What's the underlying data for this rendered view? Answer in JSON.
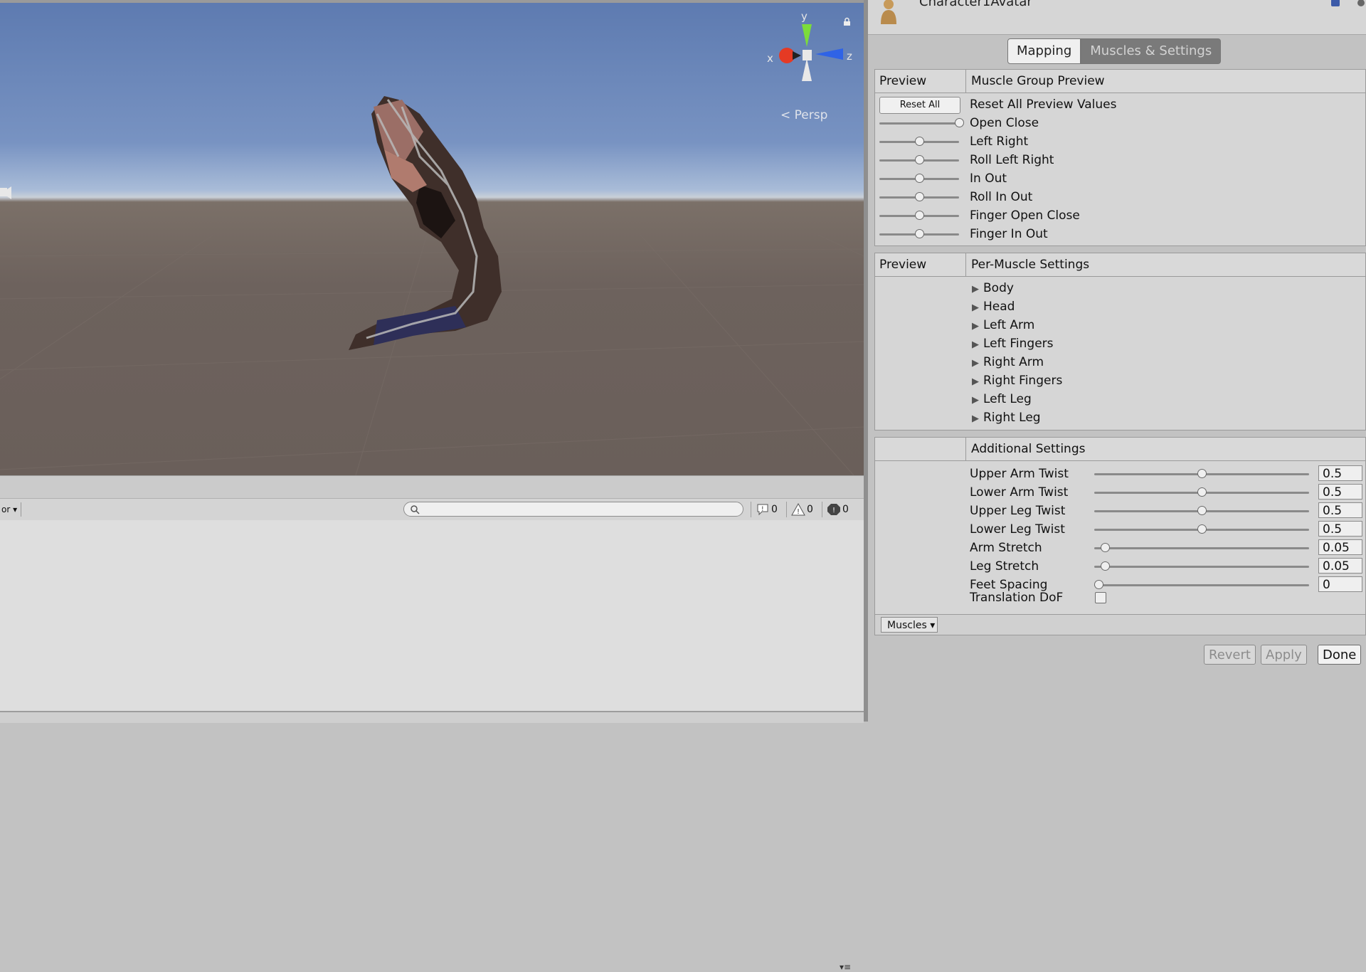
{
  "scene": {
    "projection_label": "Persp",
    "axes": {
      "x": "x",
      "y": "y",
      "z": "z"
    }
  },
  "console": {
    "menu_label": "or",
    "search_placeholder": "",
    "counts": {
      "info": "0",
      "warning": "0",
      "error": "0"
    }
  },
  "inspector": {
    "asset_title": "Character1Avatar",
    "tabs": [
      "Mapping",
      "Muscles & Settings"
    ],
    "active_tab": "Muscles & Settings",
    "muscle_group_preview": {
      "col1": "Preview",
      "col2": "Muscle Group Preview",
      "reset_button": "Reset All",
      "rows": [
        {
          "label": "Reset All Preview Values"
        },
        {
          "label": "Open Close",
          "value": 1.0
        },
        {
          "label": "Left Right",
          "value": 0.5
        },
        {
          "label": "Roll Left Right",
          "value": 0.5
        },
        {
          "label": "In Out",
          "value": 0.5
        },
        {
          "label": "Roll In Out",
          "value": 0.5
        },
        {
          "label": "Finger Open Close",
          "value": 0.5
        },
        {
          "label": "Finger In Out",
          "value": 0.5
        }
      ]
    },
    "per_muscle_settings": {
      "col1": "Preview",
      "col2": "Per-Muscle Settings",
      "items": [
        "Body",
        "Head",
        "Left Arm",
        "Left Fingers",
        "Right Arm",
        "Right Fingers",
        "Left Leg",
        "Right Leg"
      ]
    },
    "additional_settings": {
      "col1": "",
      "col2": "Additional Settings",
      "rows": [
        {
          "label": "Upper Arm Twist",
          "value": "0.5",
          "level": 0.5
        },
        {
          "label": "Lower Arm Twist",
          "value": "0.5",
          "level": 0.5
        },
        {
          "label": "Upper Leg Twist",
          "value": "0.5",
          "level": 0.5
        },
        {
          "label": "Lower Leg Twist",
          "value": "0.5",
          "level": 0.5
        },
        {
          "label": "Arm Stretch",
          "value": "0.05",
          "level": 0.05
        },
        {
          "label": "Leg Stretch",
          "value": "0.05",
          "level": 0.05
        },
        {
          "label": "Feet Spacing",
          "value": "0",
          "level": 0
        }
      ],
      "translation_dof_label": "Translation DoF",
      "translation_dof_checked": false,
      "dropdown_label": "Muscles"
    },
    "buttons": {
      "revert": "Revert",
      "apply": "Apply",
      "done": "Done"
    }
  }
}
